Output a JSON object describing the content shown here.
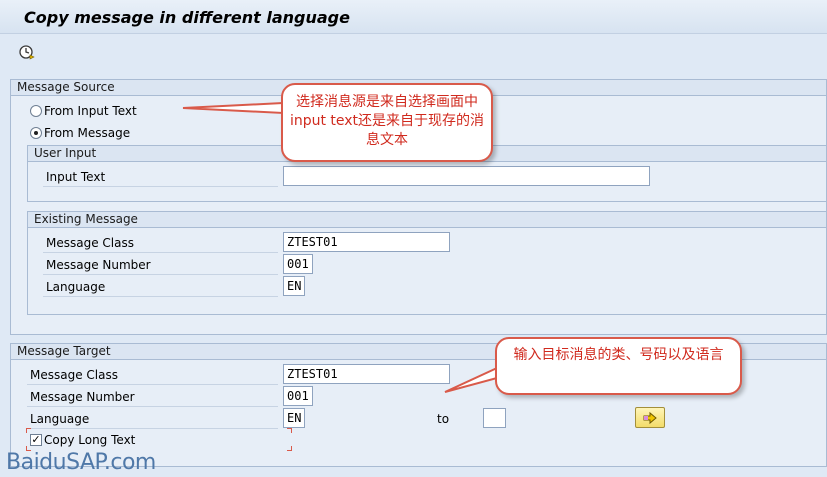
{
  "window": {
    "title": "Copy message in different language"
  },
  "toolbar": {
    "execute_icon": "execute-clock-icon"
  },
  "source": {
    "title": "Message Source",
    "radio_input_text": "From Input Text",
    "radio_from_message": "From Message",
    "selected": "From Message",
    "user_input": {
      "title": "User Input",
      "input_text_label": "Input Text",
      "input_text_value": ""
    },
    "existing": {
      "title": "Existing Message",
      "class_label": "Message Class",
      "class_value": "ZTEST01",
      "number_label": "Message Number",
      "number_value": "001",
      "language_label": "Language",
      "language_value": "EN"
    }
  },
  "target": {
    "title": "Message Target",
    "class_label": "Message Class",
    "class_value": "ZTEST01",
    "number_label": "Message Number",
    "number_value": "001",
    "language_label": "Language",
    "language_value": "EN",
    "to_label": "to",
    "to_value": "",
    "copy_long_text_label": "Copy Long Text",
    "copy_long_text_checked": true,
    "multiple_selection_icon": "multiple-selection-arrow-icon"
  },
  "annotations": {
    "callout_source": "选择消息源是来自选择画面中input  text还是来自于现存的消息文本",
    "callout_target": "输入目标消息的类、号码以及语言",
    "colors": {
      "callout_border": "#d95a4a",
      "callout_text": "#d02a1e"
    }
  },
  "watermark": "BaiduSAP.com"
}
